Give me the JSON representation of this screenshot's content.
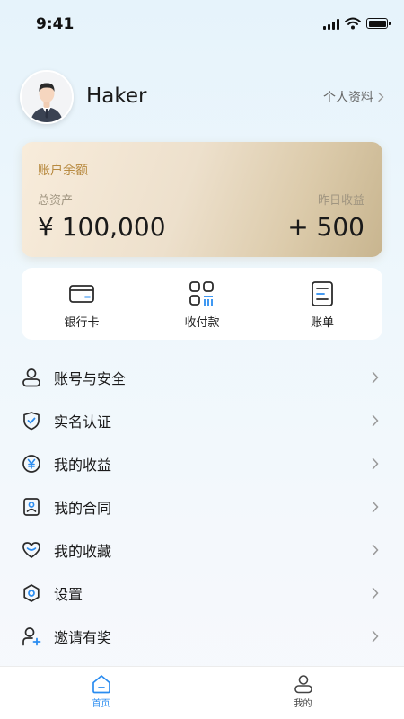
{
  "status": {
    "time": "9:41"
  },
  "profile": {
    "username": "Haker",
    "link_label": "个人资料"
  },
  "balance_card": {
    "title": "账户余额",
    "total_label": "总资产",
    "total_value": "¥ 100,000",
    "yesterday_label": "昨日收益",
    "yesterday_value": "+ 500"
  },
  "quick_actions": [
    {
      "label": "银行卡",
      "icon": "bank-card-icon"
    },
    {
      "label": "收付款",
      "icon": "qr-code-icon"
    },
    {
      "label": "账单",
      "icon": "bill-icon"
    }
  ],
  "menu": [
    {
      "label": "账号与安全",
      "icon": "user-icon"
    },
    {
      "label": "实名认证",
      "icon": "shield-check-icon"
    },
    {
      "label": "我的收益",
      "icon": "yen-icon"
    },
    {
      "label": "我的合同",
      "icon": "contract-icon"
    },
    {
      "label": "我的收藏",
      "icon": "heart-icon"
    },
    {
      "label": "设置",
      "icon": "gear-icon"
    },
    {
      "label": "邀请有奖",
      "icon": "invite-user-icon"
    }
  ],
  "tabbar": {
    "home_label": "首页",
    "mine_label": "我的",
    "active": "首页"
  },
  "colors": {
    "accent": "#2a8cf0",
    "card_title": "#b88a40"
  }
}
